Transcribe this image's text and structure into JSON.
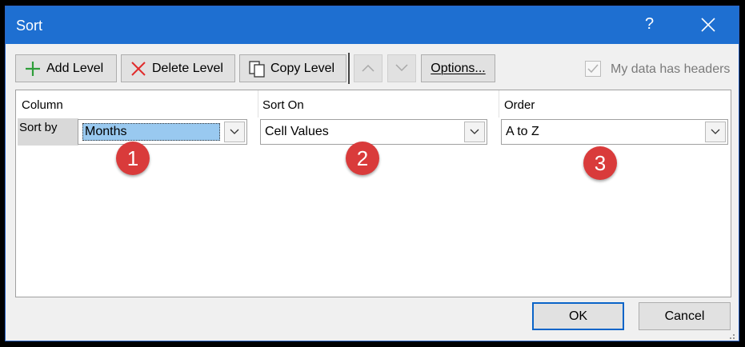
{
  "window": {
    "title": "Sort",
    "help": "?"
  },
  "toolbar": {
    "add_level": "Add Level",
    "delete_level": "Delete Level",
    "copy_level": "Copy Level",
    "options": "Options...",
    "headers_label": "My data has headers"
  },
  "columns": {
    "column": "Column",
    "sort_on": "Sort On",
    "order": "Order"
  },
  "row": {
    "label": "Sort by",
    "column_value": "Months",
    "sort_on_value": "Cell Values",
    "order_value": "A to Z"
  },
  "badges": [
    "1",
    "2",
    "3"
  ],
  "buttons": {
    "ok": "OK",
    "cancel": "Cancel"
  },
  "colors": {
    "titlebar": "#1e6fd1",
    "badge": "#d93b3b",
    "selection": "#99c9f0"
  }
}
